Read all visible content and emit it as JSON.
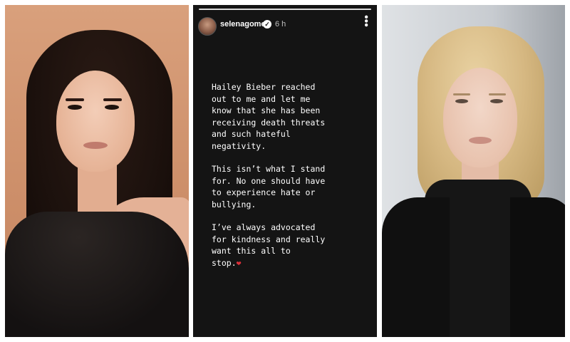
{
  "story": {
    "username": "selenagomez",
    "verified_mark": "✓",
    "time_ago": "6 h",
    "more_glyph": "•••",
    "paragraphs": [
      "Hailey Bieber reached\nout to me and let me\nknow that she has been\nreceiving death threats\nand such hateful\nnegativity.",
      "This isn’t what I stand\nfor. No one should have\nto experience hate or\nbullying.",
      "I’ve always advocated\nfor kindness and really\nwant this all to\nstop."
    ],
    "heart_glyph": "❤",
    "heart_color": "#e0303a"
  },
  "colors": {
    "story_background": "#141414",
    "text": "#ffffff",
    "left_backdrop": "#d9a07c",
    "right_backdrop": "#dfe2e5"
  }
}
